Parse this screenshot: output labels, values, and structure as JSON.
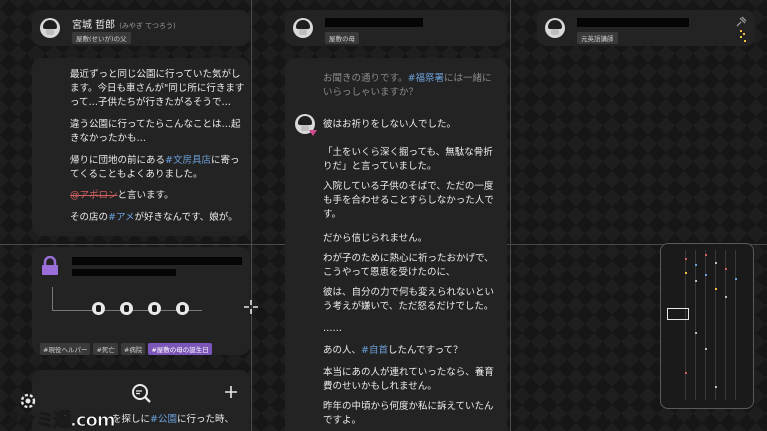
{
  "colors": {
    "accent_blue": "#6b9fd8",
    "accent_red": "#d06060",
    "tag_purple": "#7b56b8"
  },
  "left_card": {
    "name": "宮城 哲郎",
    "reading": "(みやぎ てつろう)",
    "role": "屋敷(せいが)の父",
    "messages": [
      {
        "pre": "最近ずっと同じ公園に行っていた気がします。今日も車さんが\"同じ所に行きますって…子供たちが行きたがるそうで…",
        "kw": "",
        "post": ""
      },
      {
        "pre": "違う公園に行ってたらこんなことは…起きなかったかも…",
        "kw": "",
        "post": ""
      },
      {
        "pre": "帰りに団地の前にある",
        "kw": "#文房具店",
        "post": "に寄ってくることもよくありました。"
      },
      {
        "pre": "",
        "kw": "@アポロン",
        "post": "と言います。"
      },
      {
        "pre": "その店の",
        "kw": "#アメ",
        "post": "が好きなんです、娘が。"
      }
    ]
  },
  "locked_card": {
    "tags": [
      "#現役ヘルパー",
      "#死亡",
      "#病院",
      "#屋敷の母の誕生日"
    ]
  },
  "search_card": {
    "prompt_pre": "を探しに",
    "prompt_kw": "#公園",
    "prompt_post": "に行った時、"
  },
  "center_card": {
    "role": "屋敷の母",
    "quoted_pre": "お聞きの通りです。",
    "quoted_kw": "#福祭署",
    "quoted_post": "には一緒にいらっしゃいますか？",
    "messages": [
      {
        "pre": "彼はお祈りをしない人でした。",
        "kw": "",
        "post": ""
      },
      {
        "pre": "「土をいくら深く掘っても、無駄な骨折りだ」と言っていました。",
        "kw": "",
        "post": ""
      },
      {
        "pre": "入院している子供のそばで、ただの一度も手を合わせることすらしなかった人です。",
        "kw": "",
        "post": ""
      },
      {
        "pre": "だから信じられません。",
        "kw": "",
        "post": ""
      },
      {
        "pre": "わが子のために熱心に祈ったおかげで、こうやって恩恵を受けたのに、",
        "kw": "",
        "post": ""
      },
      {
        "pre": "彼は、自分の力で何も変えられないという考えが嫌いで、ただ怒るだけでした。",
        "kw": "",
        "post": ""
      },
      {
        "pre": "……",
        "kw": "",
        "post": ""
      },
      {
        "pre": "あの人、",
        "kw": "#自首",
        "post": "したんですって？"
      },
      {
        "pre": "本当にあの人が連れていったなら、養育費のせいかもしれません。",
        "kw": "",
        "post": ""
      },
      {
        "pre": "昨年の中頃から何度か私に訴えていたんですよ。",
        "kw": "",
        "post": ""
      }
    ]
  },
  "right_card": {
    "role": "元英語講師"
  },
  "watermark": "ファミ通.com"
}
